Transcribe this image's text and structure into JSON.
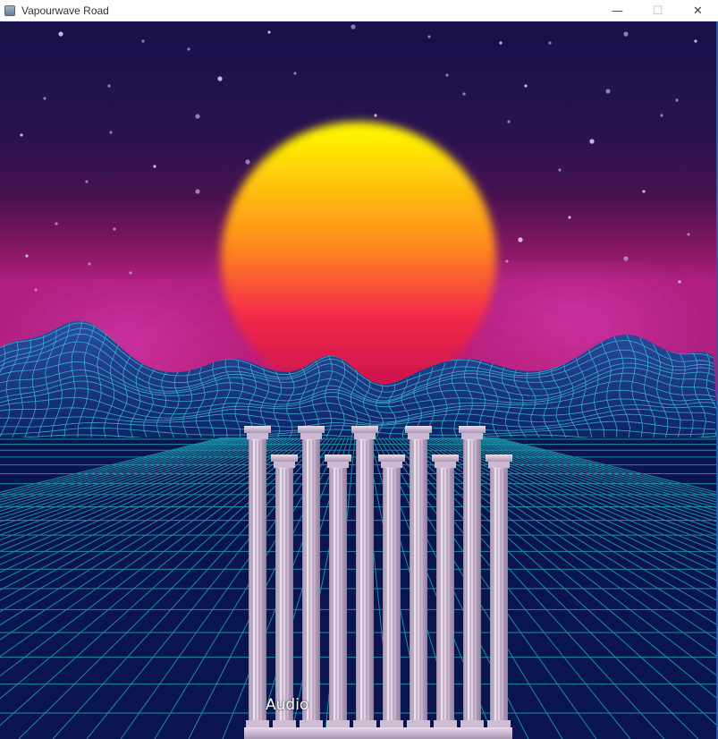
{
  "window": {
    "title": "Vapourwave Road",
    "controls": {
      "minimize": "—",
      "maximize": "☐",
      "close": "✕"
    }
  },
  "scene": {
    "caption": "Audio",
    "colors": {
      "sky_top": "#17114a",
      "sky_mid": "#4a1150",
      "horizon_glow": "#d03aa8",
      "sun_top": "#fff200",
      "sun_mid": "#ff8a1c",
      "sun_bottom": "#e8104f",
      "grid_line": "#1fb5c0",
      "floor": "#0a1550",
      "mountain": "#1a3c8c",
      "pillar": "#d9c6dc"
    }
  }
}
